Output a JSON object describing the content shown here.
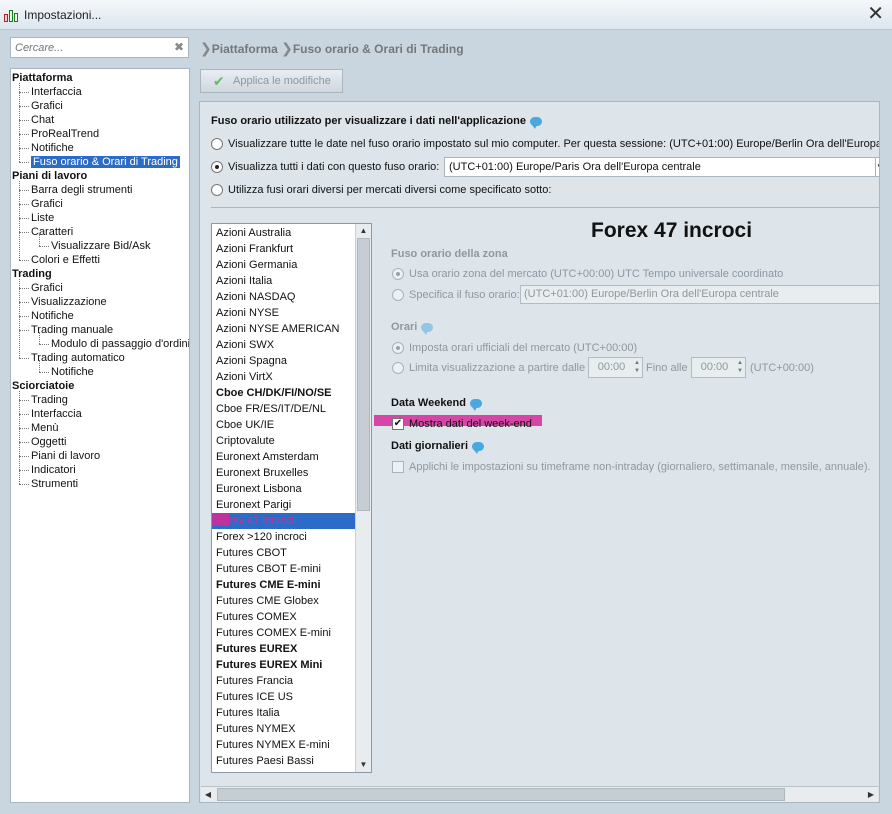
{
  "window": {
    "title": "Impostazioni...",
    "close_label": "✕"
  },
  "search": {
    "placeholder": "Cercare...",
    "clear_label": "✖"
  },
  "tree": {
    "groups": [
      {
        "label": "Piattaforma",
        "items": [
          "Interfaccia",
          "Grafici",
          "Chat",
          "ProRealTrend",
          "Notifiche",
          "Fuso orario & Orari di Trading"
        ]
      },
      {
        "label": "Piani di lavoro",
        "items": [
          "Barra degli strumenti",
          "Grafici",
          "Liste",
          "Caratteri",
          "Visualizzare Bid/Ask",
          "Colori e Effetti"
        ]
      },
      {
        "label": "Trading",
        "items": [
          "Grafici",
          "Visualizzazione",
          "Notifiche",
          "Trading manuale",
          "Modulo di passaggio d'ordini",
          "Trading automatico",
          "Notifiche"
        ]
      },
      {
        "label": "Sciorciatoie",
        "items": [
          "Trading",
          "Interfaccia",
          "Menù",
          "Oggetti",
          "Piani di lavoro",
          "Indicatori",
          "Strumenti"
        ]
      }
    ],
    "selected": "Fuso orario & Orari di Trading"
  },
  "breadcrumb": {
    "root": "Piattaforma",
    "current": "Fuso orario & Orari di Trading"
  },
  "toolbar": {
    "apply_label": "Applica le modifiche"
  },
  "timezone_section": {
    "title": "Fuso orario utilizzato per visualizzare i dati nell'applicazione",
    "options": [
      "Visualizzare tutte le date nel fuso orario impostato sul mio computer. Per questa sessione: (UTC+01:00) Europe/Berlin Ora dell'Europa ce",
      "Visualizza tutti i dati con questo fuso orario:",
      "Utilizza fusi orari diversi per mercati diversi come specificato sotto:"
    ],
    "selected_index": 1,
    "selected_timezone": "(UTC+01:00) Europe/Paris Ora dell'Europa centrale"
  },
  "markets": {
    "items": [
      {
        "label": "Azioni Australia",
        "bold": false
      },
      {
        "label": "Azioni Frankfurt",
        "bold": false
      },
      {
        "label": "Azioni Germania",
        "bold": false
      },
      {
        "label": "Azioni Italia",
        "bold": false
      },
      {
        "label": "Azioni NASDAQ",
        "bold": false
      },
      {
        "label": "Azioni NYSE",
        "bold": false
      },
      {
        "label": "Azioni NYSE AMERICAN",
        "bold": false
      },
      {
        "label": "Azioni SWX",
        "bold": false
      },
      {
        "label": "Azioni Spagna",
        "bold": false
      },
      {
        "label": "Azioni VirtX",
        "bold": false
      },
      {
        "label": "Cboe CH/DK/FI/NO/SE",
        "bold": true
      },
      {
        "label": "Cboe FR/ES/IT/DE/NL",
        "bold": false
      },
      {
        "label": "Cboe UK/IE",
        "bold": false
      },
      {
        "label": "Criptovalute",
        "bold": false
      },
      {
        "label": "Euronext Amsterdam",
        "bold": false
      },
      {
        "label": "Euronext Bruxelles",
        "bold": false
      },
      {
        "label": "Euronext Lisbona",
        "bold": false
      },
      {
        "label": "Euronext Parigi",
        "bold": false
      },
      {
        "label": "Forex 47 incroci",
        "bold": false
      },
      {
        "label": "Forex >120 incroci",
        "bold": false
      },
      {
        "label": "Futures CBOT",
        "bold": false
      },
      {
        "label": "Futures CBOT E-mini",
        "bold": false
      },
      {
        "label": "Futures CME E-mini",
        "bold": true
      },
      {
        "label": "Futures CME Globex",
        "bold": false
      },
      {
        "label": "Futures COMEX",
        "bold": false
      },
      {
        "label": "Futures COMEX E-mini",
        "bold": false
      },
      {
        "label": "Futures EUREX",
        "bold": true
      },
      {
        "label": "Futures EUREX Mini",
        "bold": true
      },
      {
        "label": "Futures Francia",
        "bold": false
      },
      {
        "label": "Futures ICE US",
        "bold": false
      },
      {
        "label": "Futures Italia",
        "bold": false
      },
      {
        "label": "Futures NYMEX",
        "bold": false
      },
      {
        "label": "Futures NYMEX E-mini",
        "bold": false
      },
      {
        "label": "Futures Paesi Bassi",
        "bold": false
      }
    ],
    "selected": "Forex 47 incroci"
  },
  "detail": {
    "market_title": "Forex 47 incroci",
    "zone_section": {
      "title": "Fuso orario della zona",
      "option_market": "Usa orario zona del mercato (UTC+00:00) UTC Tempo universale coordinato",
      "option_specify": "Specifica il fuso orario:",
      "specify_value": "(UTC+01:00) Europe/Berlin Ora dell'Europa centrale"
    },
    "hours_section": {
      "title": "Orari",
      "option_official": "Imposta orari ufficiali del mercato  (UTC+00:00)",
      "option_limit": "Limita visualizzazione  a partire dalle",
      "from_value": "00:00",
      "to_label": "Fino alle",
      "to_value": "00:00",
      "tz_suffix": "(UTC+00:00)"
    },
    "weekend_section": {
      "title": "Data Weekend",
      "checkbox_label": "Mostra dati del week-end",
      "checked": true
    },
    "daily_section": {
      "title": "Dati giornalieri",
      "checkbox_label": "Applichi le impostazioni su timeframe non-intraday (giornaliero, settimanale, mensile, annuale).",
      "checked": false
    }
  },
  "colors": {
    "accent": "#2c6bc7",
    "highlight": "#d42a9a",
    "panel": "#dde5ea"
  }
}
